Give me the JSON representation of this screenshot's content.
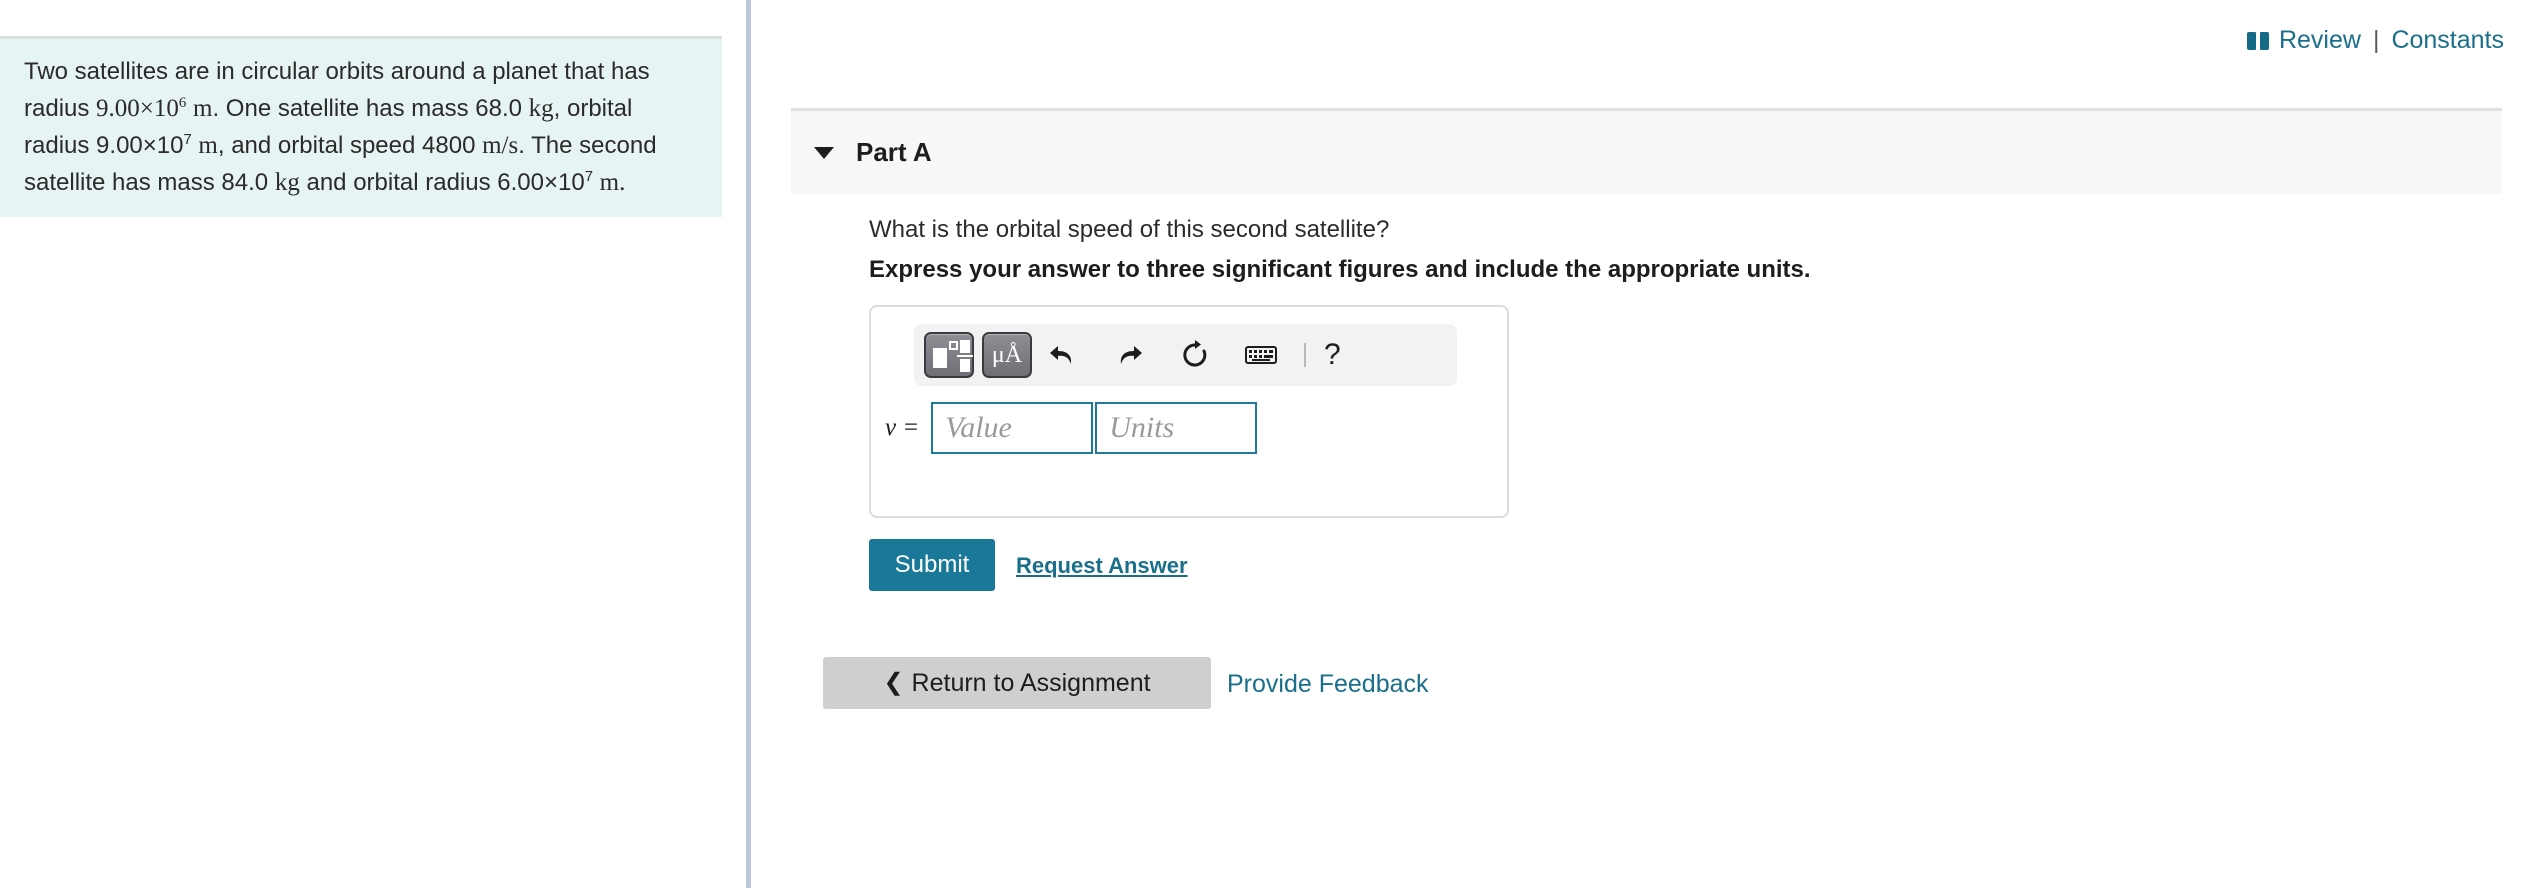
{
  "header": {
    "book_icon": "book-icon",
    "review_label": "Review",
    "separator": "|",
    "constants_label": "Constants"
  },
  "problem": {
    "intro": "Two satellites are in circular orbits around a planet that has radius",
    "planet_radius_value": "9.00",
    "times_symbol": "×",
    "planet_radius_base": "10",
    "planet_radius_exponent": "6",
    "planet_radius_unit": "m",
    "sat1_intro": ". One satellite has mass",
    "sat1_mass": "68.0",
    "sat1_mass_unit": "kg",
    "sat1_orbit_label": ", orbital radius",
    "sat1_radius": "9.00×10",
    "sat1_radius_exponent": "7",
    "sat1_radius_unit": "m",
    "sat1_speed_label": ", and orbital speed",
    "sat1_speed": "4800",
    "sat1_speed_unit": "m/s",
    "sat2_intro": ". The second satellite has mass",
    "sat2_mass": "84.0",
    "sat2_mass_unit": "kg",
    "sat2_orbit_label": "and orbital radius",
    "sat2_radius": "6.00×10",
    "sat2_radius_exponent": "7",
    "sat2_radius_unit": "m",
    "period": "."
  },
  "part": {
    "toggle_icon": "triangle-down-icon",
    "title": "Part A",
    "question": "What is the orbital speed of this second satellite?",
    "instruction": "Express your answer to three significant figures and include the appropriate units."
  },
  "answer_widget": {
    "toolbar": {
      "template_button": "math-template-button",
      "units_button_label": "μÅ",
      "undo_icon": "undo-arrow-icon",
      "redo_icon": "redo-arrow-icon",
      "reset_icon": "reset-circle-icon",
      "keyboard_icon": "keyboard-icon",
      "help_label": "?"
    },
    "variable_label": "v =",
    "value_placeholder": "Value",
    "value": "",
    "units_placeholder": "Units",
    "units": ""
  },
  "actions": {
    "submit_label": "Submit",
    "request_answer_label": "Request Answer",
    "return_chevron": "❮",
    "return_label": "Return to Assignment",
    "provide_feedback_label": "Provide Feedback"
  },
  "colors": {
    "teal_accent": "#1a7899",
    "link_teal": "#1a6f8a",
    "problem_bg": "#e6f4f3",
    "part_header_bg": "#f7f7f7",
    "divider_blue": "#b9c9db",
    "return_button_bg": "#cfcfcf",
    "field_border_teal": "#1c7c99"
  }
}
